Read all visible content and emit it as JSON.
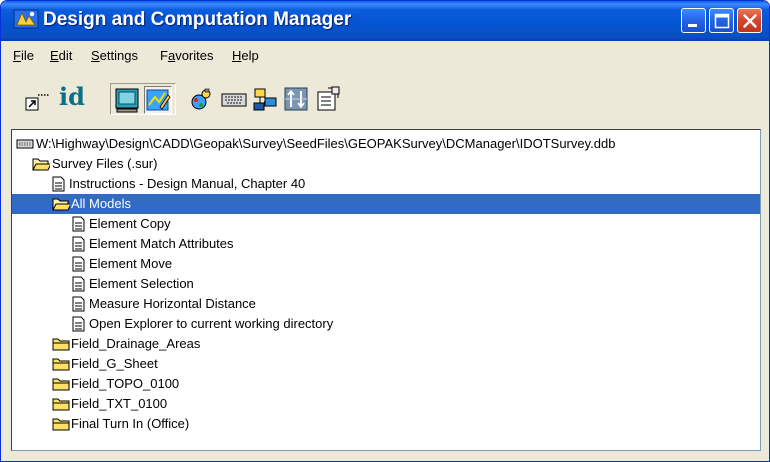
{
  "window": {
    "title": "Design and Computation Manager"
  },
  "colors": {
    "titlebar": "#0453d1",
    "selection": "#316ac5",
    "window_bg": "#ece9d8"
  },
  "menu": {
    "items": [
      {
        "label": "File"
      },
      {
        "label": "Edit"
      },
      {
        "label": "Settings"
      },
      {
        "label": "Favorites"
      },
      {
        "label": "Help"
      }
    ]
  },
  "toolbar": {
    "tools": [
      {
        "icon": "shortcut-arrow-icon"
      },
      {
        "icon": "id-icon",
        "text": "id"
      },
      {
        "icon": "monitor-icon"
      },
      {
        "icon": "pencil-chart-icon",
        "pressed": true
      },
      {
        "icon": "palette-icon"
      },
      {
        "icon": "keyboard-icon"
      },
      {
        "icon": "tree-icon"
      },
      {
        "icon": "arrows-grid-icon"
      },
      {
        "icon": "properties-icon"
      }
    ]
  },
  "tree": {
    "root": {
      "icon": "database-icon",
      "label": "W:\\Highway\\Design\\CADD\\Geopak\\Survey\\SeedFiles\\GEOPAKSurvey\\DCManager\\IDOTSurvey.ddb"
    },
    "items": [
      {
        "label": "Survey Files (.sur)",
        "icon": "folder-open-icon",
        "level": 1
      },
      {
        "label": "Instructions  - Design Manual, Chapter 40",
        "icon": "document-icon",
        "level": 2
      },
      {
        "label": "All Models",
        "icon": "folder-open-icon",
        "level": 2,
        "selected": true
      },
      {
        "label": "Element Copy",
        "icon": "document-icon",
        "level": 3
      },
      {
        "label": "Element Match Attributes",
        "icon": "document-icon",
        "level": 3
      },
      {
        "label": "Element Move",
        "icon": "document-icon",
        "level": 3
      },
      {
        "label": "Element Selection",
        "icon": "document-icon",
        "level": 3
      },
      {
        "label": "Measure Horizontal Distance",
        "icon": "document-icon",
        "level": 3
      },
      {
        "label": "Open Explorer to current working directory",
        "icon": "document-icon",
        "level": 3
      },
      {
        "label": "Field_Drainage_Areas",
        "icon": "folder-closed-icon",
        "level": 2
      },
      {
        "label": "Field_G_Sheet",
        "icon": "folder-closed-icon",
        "level": 2
      },
      {
        "label": "Field_TOPO_0100",
        "icon": "folder-closed-icon",
        "level": 2
      },
      {
        "label": "Field_TXT_0100",
        "icon": "folder-closed-icon",
        "level": 2
      },
      {
        "label": "Final Turn In (Office)",
        "icon": "folder-closed-icon",
        "level": 2
      }
    ]
  }
}
